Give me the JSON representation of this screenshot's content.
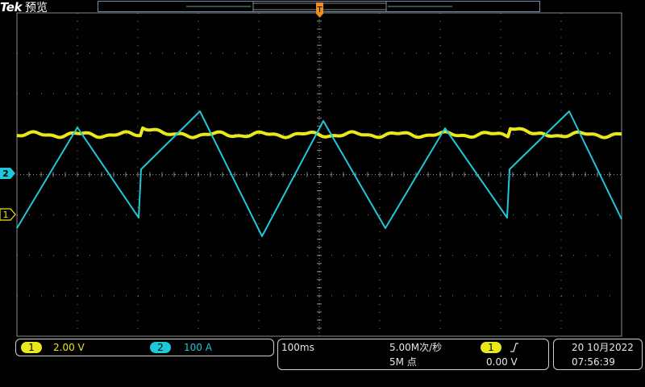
{
  "brand": {
    "name": "Tek",
    "mode": "预览"
  },
  "colors": {
    "ch1": "#e8e81a",
    "ch2": "#1ec8d8",
    "grid": "#8a8a8a",
    "trigger": "#f08c1a",
    "record": "#6f8ca8"
  },
  "markers": {
    "trigger_label": "T",
    "ch2_label": "2",
    "ch1_label": "1"
  },
  "channels": [
    {
      "badge": "1",
      "scale": "2.00 V"
    },
    {
      "badge": "2",
      "scale": "100 A"
    }
  ],
  "horizontal": {
    "timebase": "100ms",
    "sample_rate": "5.00M次/秒",
    "record_length": "5M 点"
  },
  "trigger": {
    "source": "1",
    "slope_icon": "rising-edge-icon",
    "level": "0.00 V"
  },
  "datetime": {
    "date": "20 10月2022",
    "time": "07:56:39"
  }
}
